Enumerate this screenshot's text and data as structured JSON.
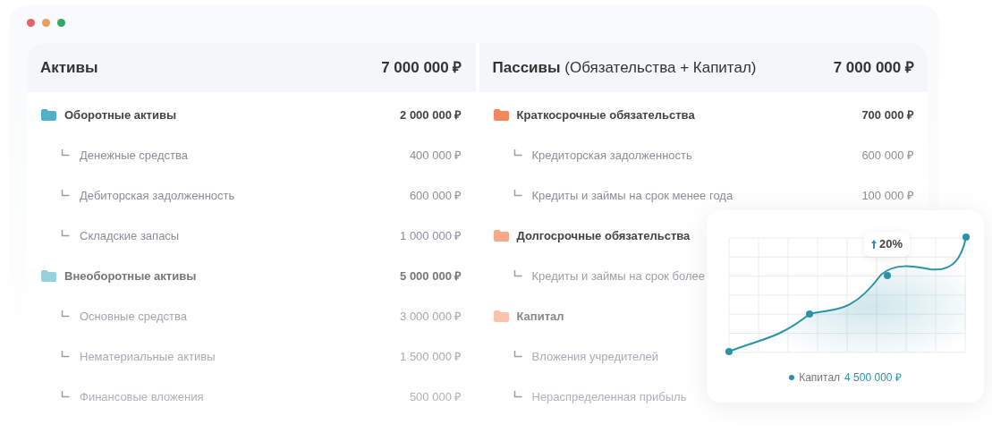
{
  "columns": [
    {
      "title": "Активы",
      "total": "7 000 000 ₽",
      "groups": [
        {
          "name": "Оборотные активы",
          "amount": "2 000 000 ₽",
          "color": "#4fb1c5",
          "children": [
            {
              "name": "Денежные средства",
              "amount": "400 000 ₽"
            },
            {
              "name": "Дебиторская задолженность",
              "amount": "600 000 ₽"
            },
            {
              "name": "Складские запасы",
              "amount": "1 000 000 ₽"
            }
          ]
        },
        {
          "name": "Внеоборотные активы",
          "amount": "5 000 000 ₽",
          "color": "#94d3de",
          "children": [
            {
              "name": "Основные средства",
              "amount": "3 000 000 ₽"
            },
            {
              "name": "Нематериальные активы",
              "amount": "1 500 000 ₽"
            },
            {
              "name": "Финансовые вложения",
              "amount": "500 000 ₽"
            }
          ]
        }
      ]
    },
    {
      "title": "Пассивы",
      "title_note": "(Обязательства + Капитал)",
      "total": "7 000 000 ₽",
      "groups": [
        {
          "name": "Краткосрочные обязательства",
          "amount": "700 000 ₽",
          "color": "#f5875f",
          "children": [
            {
              "name": "Кредиторская задолженность",
              "amount": "600 000 ₽"
            },
            {
              "name": "Кредиты и займы на срок менее года",
              "amount": "100 000 ₽"
            }
          ]
        },
        {
          "name": "Долгосрочные обязательства",
          "color": "#f8a98a",
          "children": [
            {
              "name": "Кредиты и займы на срок более"
            }
          ]
        },
        {
          "name": "Капитал",
          "color": "#fbc3ae",
          "children": [
            {
              "name": "Вложения учредителей"
            },
            {
              "name": "Нераспределенная прибыль"
            }
          ]
        }
      ]
    }
  ],
  "chart_card": {
    "badge": "20%",
    "legend_label": "Капитал",
    "legend_value": "4 500 000 ₽"
  }
}
